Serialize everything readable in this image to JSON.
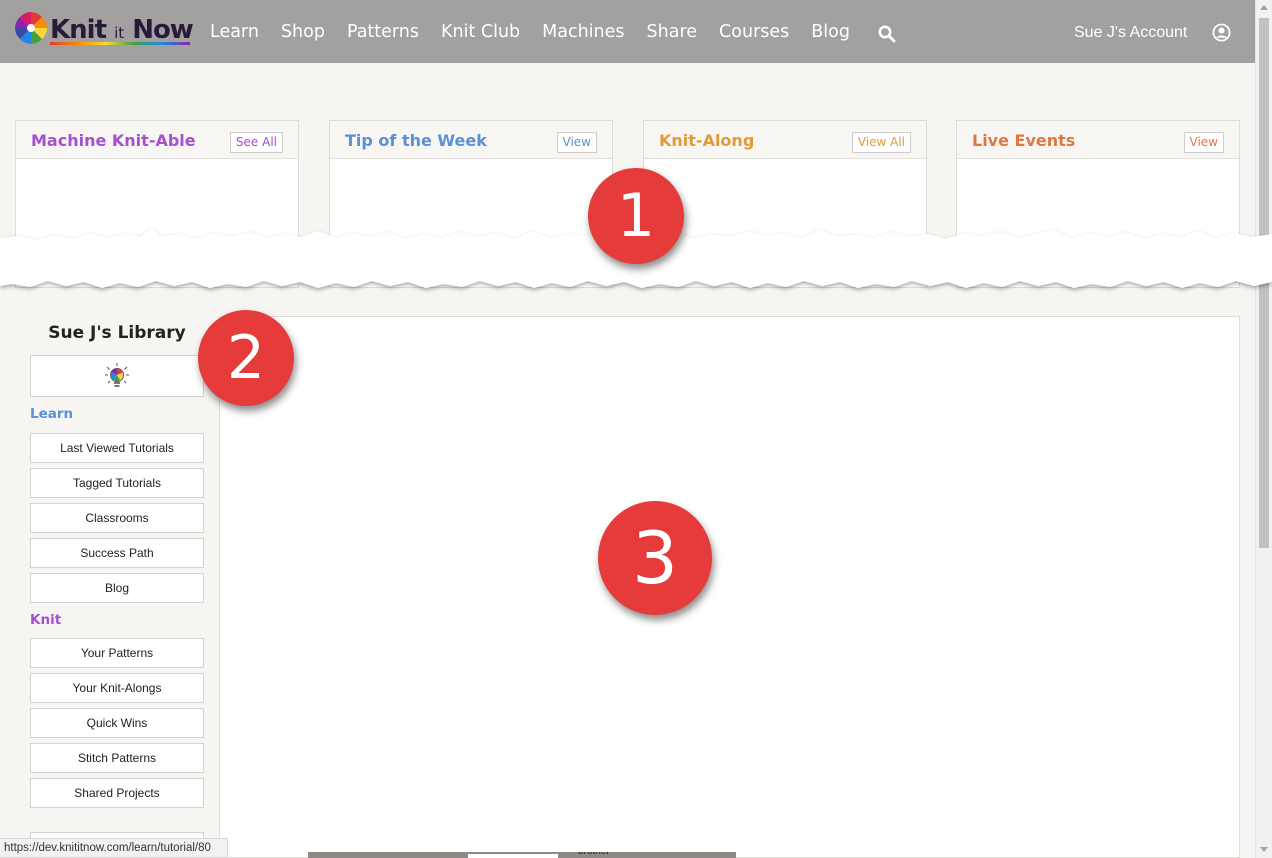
{
  "nav": {
    "logo_text_main1": "Knit",
    "logo_text_small": "it",
    "logo_text_main2": "Now",
    "items": [
      "Learn",
      "Shop",
      "Patterns",
      "Knit Club",
      "Machines",
      "Share",
      "Courses",
      "Blog"
    ],
    "account_label": "Sue J's Account",
    "search_icon": "search-icon",
    "user_icon": "user-circle-icon"
  },
  "cards": [
    {
      "title": "Machine Knit-Able",
      "button": "See All",
      "color": "#a64fd0"
    },
    {
      "title": "Tip of the Week",
      "button": "View",
      "color": "#5b90d4"
    },
    {
      "title": "Knit-Along",
      "button": "View All",
      "color": "#e29a3a"
    },
    {
      "title": "Live Events",
      "button": "View",
      "color": "#df7840"
    }
  ],
  "library": {
    "title": "Sue J's Library",
    "bulb_icon": "lightbulb-icon",
    "learn_heading": "Learn",
    "learn_color": "#5b90d4",
    "learn_items": [
      "Last Viewed Tutorials",
      "Tagged Tutorials",
      "Classrooms",
      "Success Path",
      "Blog"
    ],
    "knit_heading": "Knit",
    "knit_color": "#a64fd0",
    "knit_items": [
      "Your Patterns",
      "Your Knit-Alongs",
      "Quick Wins",
      "Stitch Patterns",
      "Shared Projects"
    ]
  },
  "badges": {
    "one": "1",
    "two": "2",
    "three": "3"
  },
  "status_url": "https://dev.knititnow.com/learn/tutorial/80",
  "bottom_peek": "brother"
}
